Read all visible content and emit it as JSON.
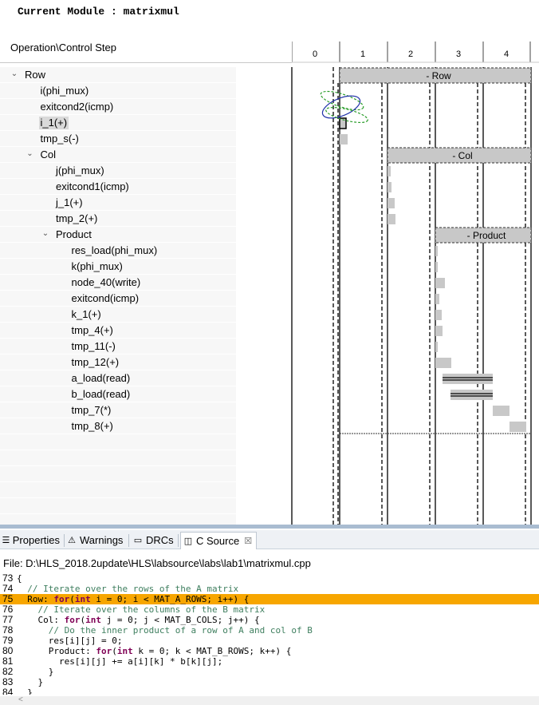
{
  "module": {
    "title": "Current Module : matrixmul"
  },
  "analysis": {
    "header_label": "Operation\\Control Step",
    "steps": [
      "0",
      "1",
      "2",
      "3",
      "4"
    ],
    "loops": [
      {
        "label": "- Row"
      },
      {
        "label": "- Col"
      },
      {
        "label": "- Product"
      }
    ],
    "tree": [
      {
        "label": "Row",
        "depth": 0,
        "twisty": "expanded"
      },
      {
        "label": "i(phi_mux)",
        "depth": 1
      },
      {
        "label": "exitcond2(icmp)",
        "depth": 1
      },
      {
        "label": "i_1(+)",
        "depth": 1,
        "selected": true
      },
      {
        "label": "tmp_s(-)",
        "depth": 1
      },
      {
        "label": "Col",
        "depth": 1,
        "twisty": "expanded"
      },
      {
        "label": "j(phi_mux)",
        "depth": 2
      },
      {
        "label": "exitcond1(icmp)",
        "depth": 2
      },
      {
        "label": "j_1(+)",
        "depth": 2
      },
      {
        "label": "tmp_2(+)",
        "depth": 2
      },
      {
        "label": "Product",
        "depth": 2,
        "twisty": "expanded"
      },
      {
        "label": "res_load(phi_mux)",
        "depth": 3
      },
      {
        "label": "k(phi_mux)",
        "depth": 3
      },
      {
        "label": "node_40(write)",
        "depth": 3
      },
      {
        "label": "exitcond(icmp)",
        "depth": 3
      },
      {
        "label": "k_1(+)",
        "depth": 3
      },
      {
        "label": "tmp_4(+)",
        "depth": 3
      },
      {
        "label": "tmp_11(-)",
        "depth": 3
      },
      {
        "label": "tmp_12(+)",
        "depth": 3
      },
      {
        "label": "a_load(read)",
        "depth": 3
      },
      {
        "label": "b_load(read)",
        "depth": 3
      },
      {
        "label": "tmp_7(*)",
        "depth": 3
      },
      {
        "label": "tmp_8(+)",
        "depth": 3
      }
    ]
  },
  "tabs": [
    {
      "label": "Properties",
      "icon": "properties-icon",
      "active": false
    },
    {
      "label": "Warnings",
      "icon": "warning-icon",
      "active": false
    },
    {
      "label": "DRCs",
      "icon": "drc-icon",
      "active": false
    },
    {
      "label": "C Source",
      "icon": "c-source-icon",
      "active": true,
      "close": "☒"
    }
  ],
  "source": {
    "file_path": "File: D:\\HLS_2018.2update\\HLS\\labsource\\labs\\lab1\\matrixmul.cpp",
    "highlight_line": "75",
    "lines": [
      {
        "num": "73",
        "text": "{"
      },
      {
        "num": "74",
        "text": "  // Iterate over the rows of the A matrix"
      },
      {
        "num": "75",
        "text": "  Row: for(int i = 0; i < MAT_A_ROWS; i++) {"
      },
      {
        "num": "76",
        "text": "    // Iterate over the columns of the B matrix"
      },
      {
        "num": "77",
        "text": "    Col: for(int j = 0; j < MAT_B_COLS; j++) {"
      },
      {
        "num": "78",
        "text": "      // Do the inner product of a row of A and col of B"
      },
      {
        "num": "79",
        "text": "      res[i][j] = 0;"
      },
      {
        "num": "80",
        "text": "      Product: for(int k = 0; k < MAT_B_ROWS; k++) {"
      },
      {
        "num": "81",
        "text": "        res[i][j] += a[i][k] * b[k][j];"
      },
      {
        "num": "82",
        "text": "      }"
      },
      {
        "num": "83",
        "text": "    }"
      },
      {
        "num": "84",
        "text": "  }"
      }
    ]
  },
  "colors": {
    "highlight": "#f7a600",
    "loop_bar": "#c8c8c8",
    "op_bar": "#c8c8c8",
    "selected_row": "#d9d9d9",
    "dep_green": "#2a9d2a",
    "dep_blue": "#2233aa"
  }
}
